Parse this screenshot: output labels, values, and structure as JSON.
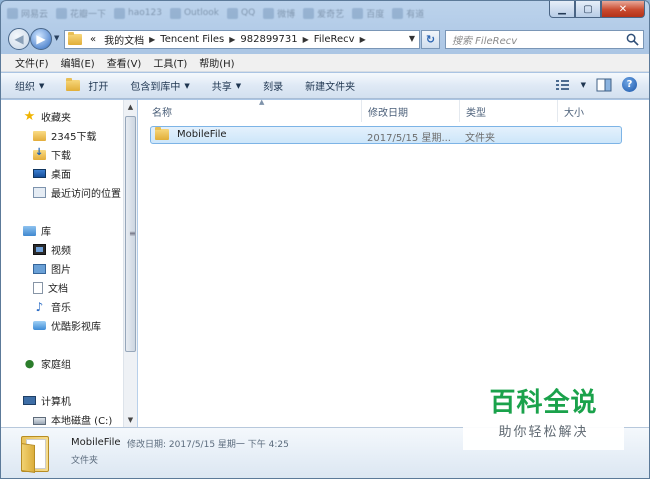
{
  "taskbar_ghosts": [
    "网易云",
    "花瓣一下",
    "hao123",
    "Outlook",
    "QQ",
    "微博",
    "爱奇艺",
    "百度",
    "有道"
  ],
  "window_controls": {
    "minimize": "▁",
    "maximize": "▢",
    "close": "✕"
  },
  "address_bar": {
    "overflow": "«",
    "crumbs": [
      "我的文档",
      "Tencent Files",
      "982899731",
      "FileRecv"
    ]
  },
  "search": {
    "placeholder": "搜索 FileRecv"
  },
  "menu": [
    "文件(F)",
    "编辑(E)",
    "查看(V)",
    "工具(T)",
    "帮助(H)"
  ],
  "commands": {
    "organize": "组织",
    "open": "打开",
    "include_library": "包含到库中",
    "share": "共享",
    "burn": "刻录",
    "new_folder": "新建文件夹"
  },
  "nav_pane": {
    "favorites": {
      "label": "收藏夹",
      "items": [
        "2345下载",
        "下载",
        "桌面",
        "最近访问的位置"
      ]
    },
    "libraries": {
      "label": "库",
      "items": [
        "视频",
        "图片",
        "文档",
        "音乐",
        "优酷影视库"
      ]
    },
    "homegroup": "家庭组",
    "computer": {
      "label": "计算机",
      "items": [
        "本地磁盘 (C:)"
      ]
    }
  },
  "columns": {
    "name": "名称",
    "modified": "修改日期",
    "type": "类型",
    "size": "大小"
  },
  "files": [
    {
      "name": "MobileFile",
      "modified": "2017/5/15 星期...",
      "type": "文件夹",
      "size": ""
    }
  ],
  "details": {
    "name": "MobileFile",
    "meta": "修改日期: 2017/5/15 星期一 下午 4:25",
    "type": "文件夹"
  },
  "watermark": {
    "main": "百科全说",
    "sub": "助你轻松解决"
  },
  "colors": {
    "accent": "#2f6bc0",
    "selection": "#cde6fa",
    "watermark_green": "#1aa24b"
  }
}
